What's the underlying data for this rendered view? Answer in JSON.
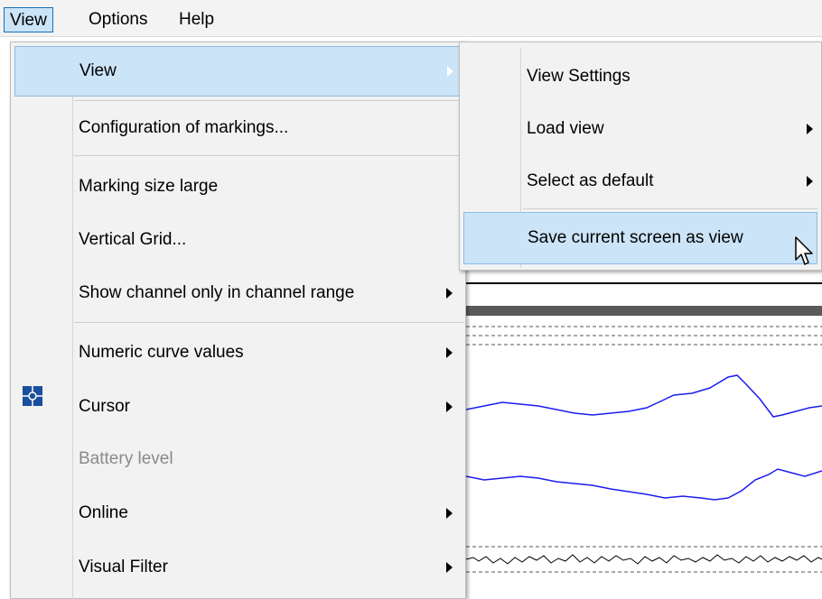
{
  "menubar": {
    "items": [
      {
        "label": "View"
      },
      {
        "label": "Options"
      },
      {
        "label": "Help"
      }
    ]
  },
  "view_menu": {
    "items": [
      {
        "label": "View",
        "submenu": true,
        "highlighted": true
      },
      {
        "label": "Configuration of markings..."
      },
      {
        "label": "Marking size large"
      },
      {
        "label": "Vertical Grid..."
      },
      {
        "label": "Show channel only in channel range",
        "submenu": true
      },
      {
        "label": "Numeric curve values",
        "submenu": true
      },
      {
        "label": "Cursor",
        "submenu": true,
        "icon": "cursor-crosshair-icon"
      },
      {
        "label": "Battery level",
        "disabled": true
      },
      {
        "label": "Online",
        "submenu": true
      },
      {
        "label": "Visual Filter",
        "submenu": true
      }
    ]
  },
  "view_submenu": {
    "items": [
      {
        "label": "View Settings"
      },
      {
        "label": "Load view",
        "submenu": true
      },
      {
        "label": "Select as default",
        "submenu": true
      },
      {
        "label": "Save current screen as view",
        "highlighted": true
      }
    ]
  },
  "colors": {
    "highlight": "#cce4f7",
    "highlight_border": "#8fbbe3",
    "signal_blue": "#1c1cf0",
    "signal_black": "#000000",
    "cursor_icon": "#1b4f9c"
  }
}
